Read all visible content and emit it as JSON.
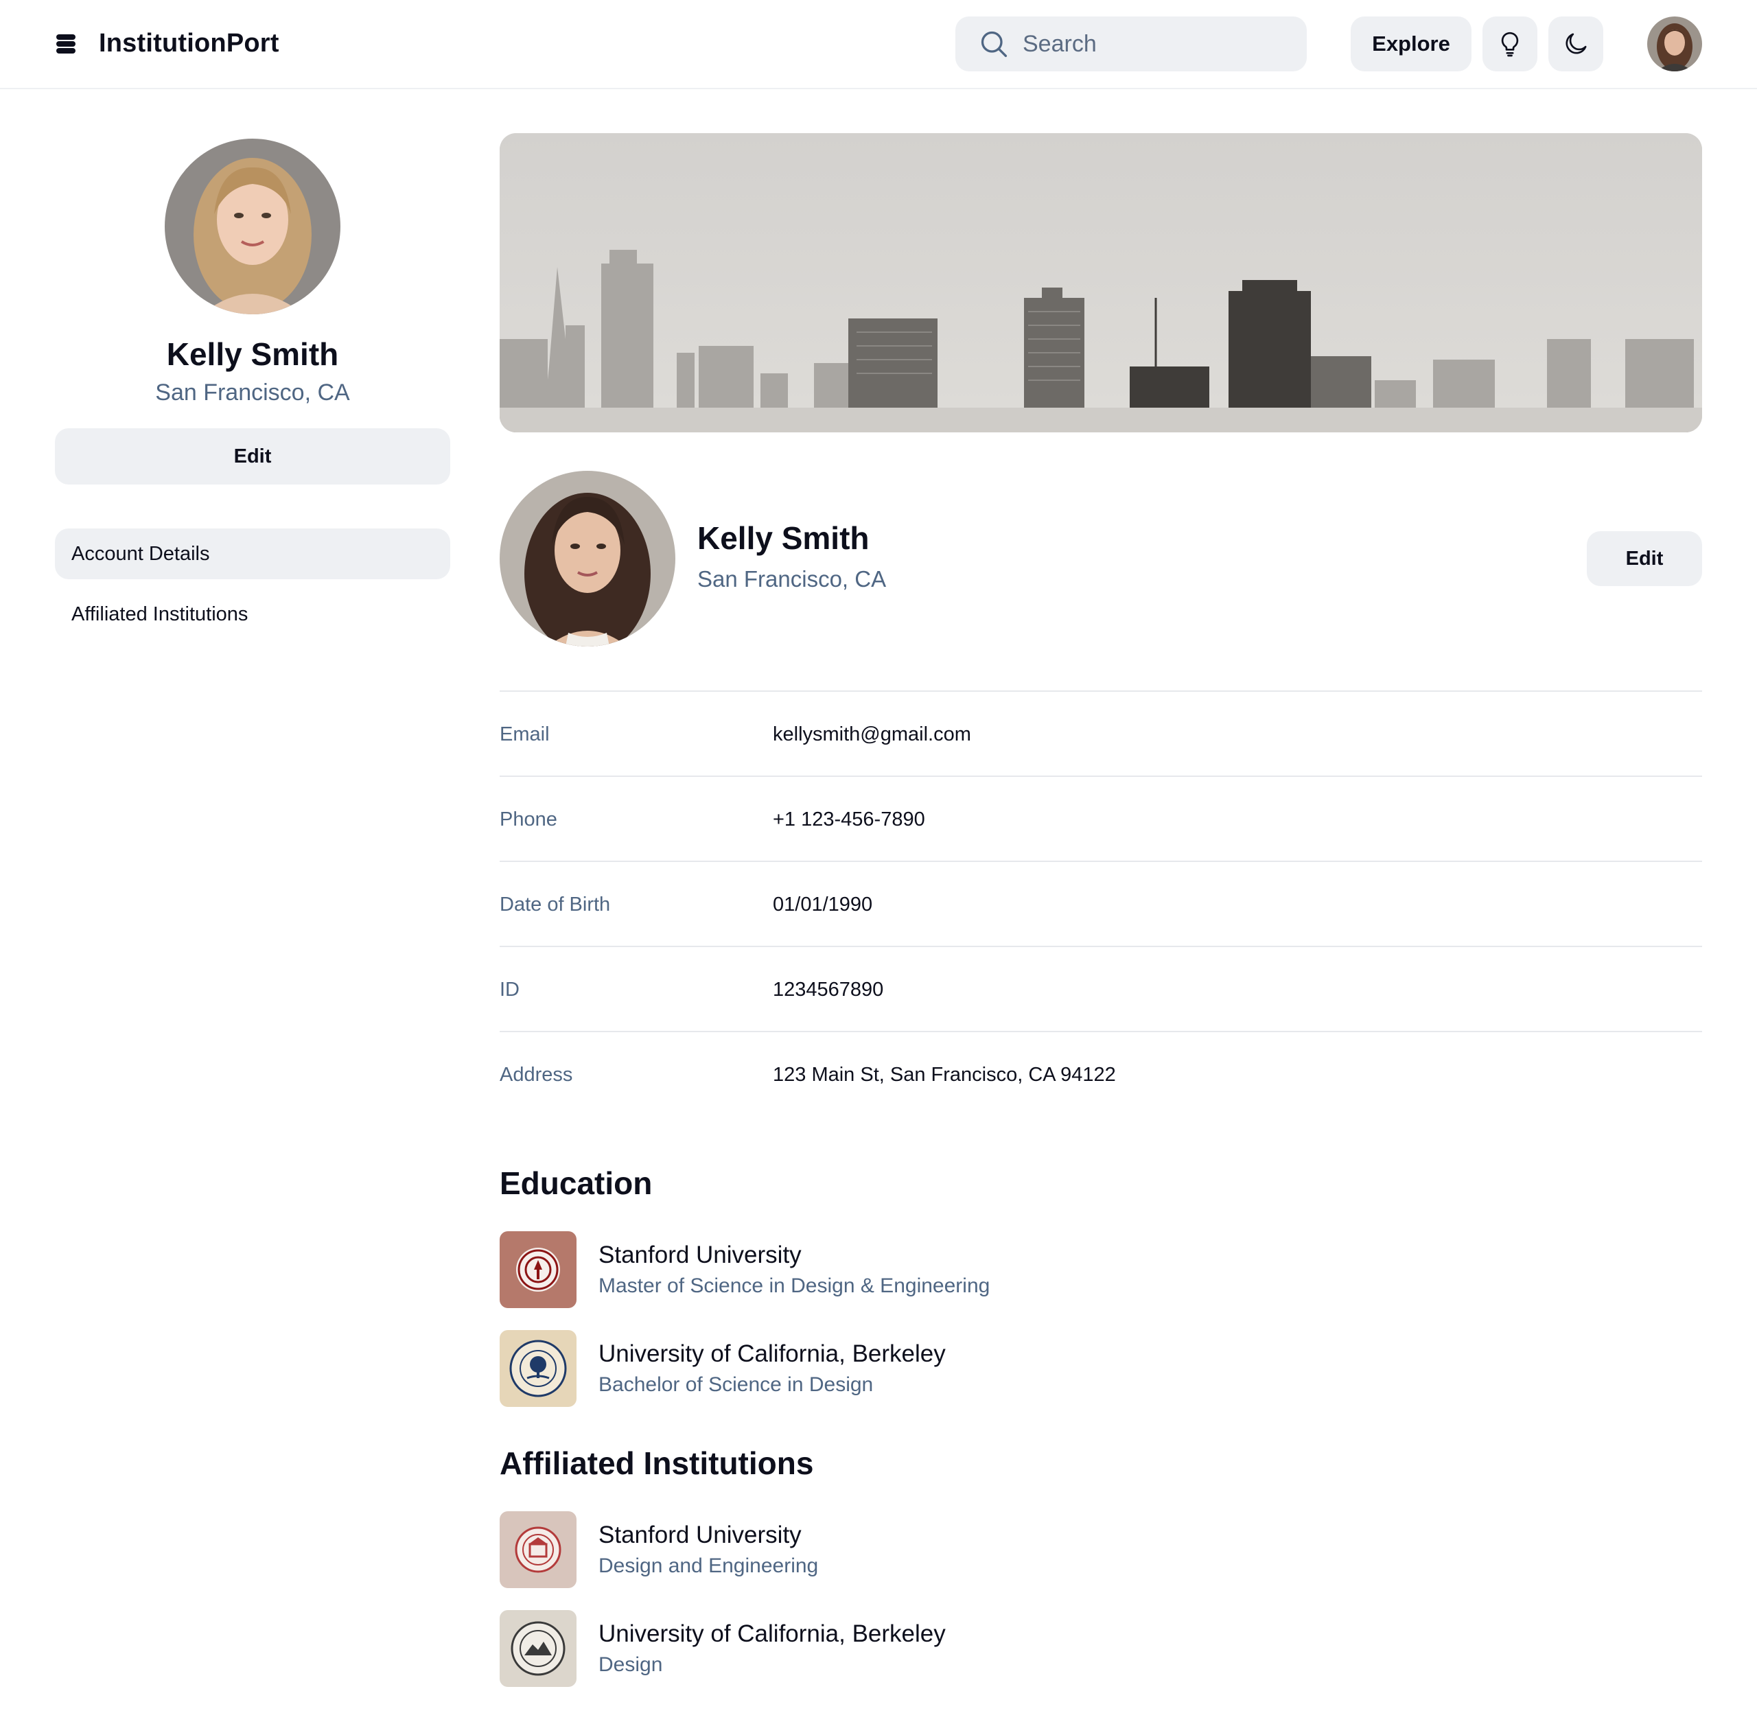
{
  "header": {
    "app_title": "InstitutionPort",
    "logo_icon": "stack-logo-icon",
    "search_placeholder": "Search",
    "explore_label": "Explore",
    "icons": [
      "search-icon",
      "lightbulb-icon",
      "moon-icon"
    ]
  },
  "sidebar": {
    "name": "Kelly Smith",
    "location": "San Francisco, CA",
    "edit_label": "Edit",
    "nav": [
      {
        "label": "Account Details",
        "active": true
      },
      {
        "label": "Affiliated Institutions",
        "active": false
      }
    ]
  },
  "profile": {
    "name": "Kelly Smith",
    "location": "San Francisco, CA",
    "edit_label": "Edit",
    "details": [
      {
        "label": "Email",
        "value": "kellysmith@gmail.com"
      },
      {
        "label": "Phone",
        "value": "+1 123-456-7890"
      },
      {
        "label": "Date of Birth",
        "value": "01/01/1990"
      },
      {
        "label": "ID",
        "value": "1234567890"
      },
      {
        "label": "Address",
        "value": "123 Main St, San Francisco, CA 94122"
      }
    ]
  },
  "education": {
    "title": "Education",
    "items": [
      {
        "name": "Stanford University",
        "subtitle": "Master of Science in Design & Engineering"
      },
      {
        "name": "University of California, Berkeley",
        "subtitle": "Bachelor of Science in Design"
      }
    ]
  },
  "affiliated": {
    "title": "Affiliated Institutions",
    "items": [
      {
        "name": "Stanford University",
        "subtitle": "Design and Engineering"
      },
      {
        "name": "University of California, Berkeley",
        "subtitle": "Design"
      }
    ]
  },
  "colors": {
    "text": "#0d0f1c",
    "muted": "#4f6683",
    "surface": "#eef0f3",
    "divider": "#e6e8ec",
    "stanford_red": "#8c1515",
    "berkeley_blue": "#1f3a68"
  }
}
